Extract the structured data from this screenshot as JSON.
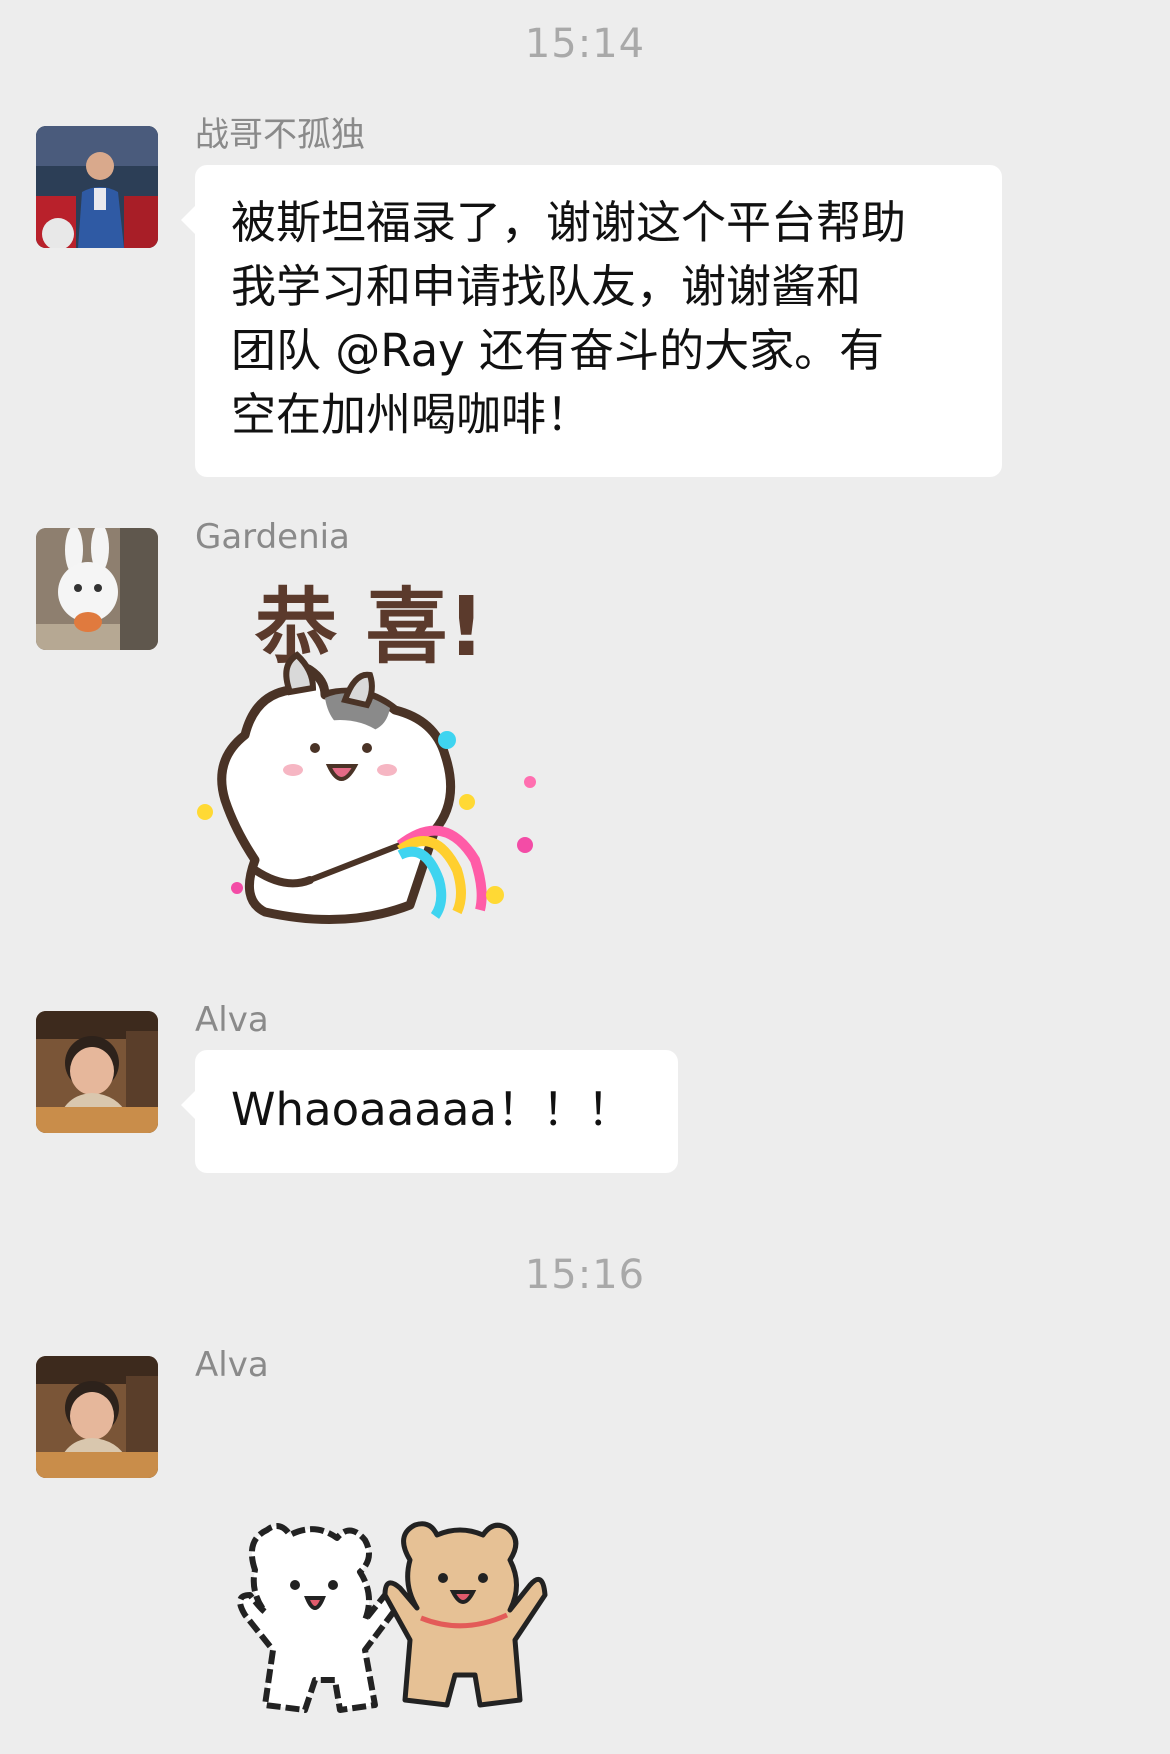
{
  "conversation": {
    "messages": [
      {
        "type": "time",
        "text": "15:14"
      },
      {
        "type": "text",
        "sender": "战哥不孤独",
        "avatar_icon": "man-in-suit-avatar",
        "text": "被斯坦福录了，谢谢这个平台帮助\n我学习和申请找队友，谢谢酱和\n团队 @Ray 还有奋斗的大家。有\n空在加州喝咖啡！"
      },
      {
        "type": "sticker",
        "sender": "Gardenia",
        "avatar_icon": "white-rabbit-avatar",
        "sticker_text": "恭 喜!",
        "sticker_icon": "hamster-rainbow-sticker"
      },
      {
        "type": "text",
        "sender": "Alva",
        "avatar_icon": "woman-smiling-avatar",
        "text": "Whaoaaaaa！！！"
      },
      {
        "type": "time",
        "text": "15:16"
      },
      {
        "type": "sticker",
        "sender": "Alva",
        "avatar_icon": "woman-smiling-avatar",
        "sticker_icon": "two-bears-dancing-sticker"
      }
    ]
  },
  "colors": {
    "background": "#ededed",
    "bubble": "#ffffff",
    "timestamp": "#a9a9a9",
    "sender": "#8a8a8a"
  }
}
